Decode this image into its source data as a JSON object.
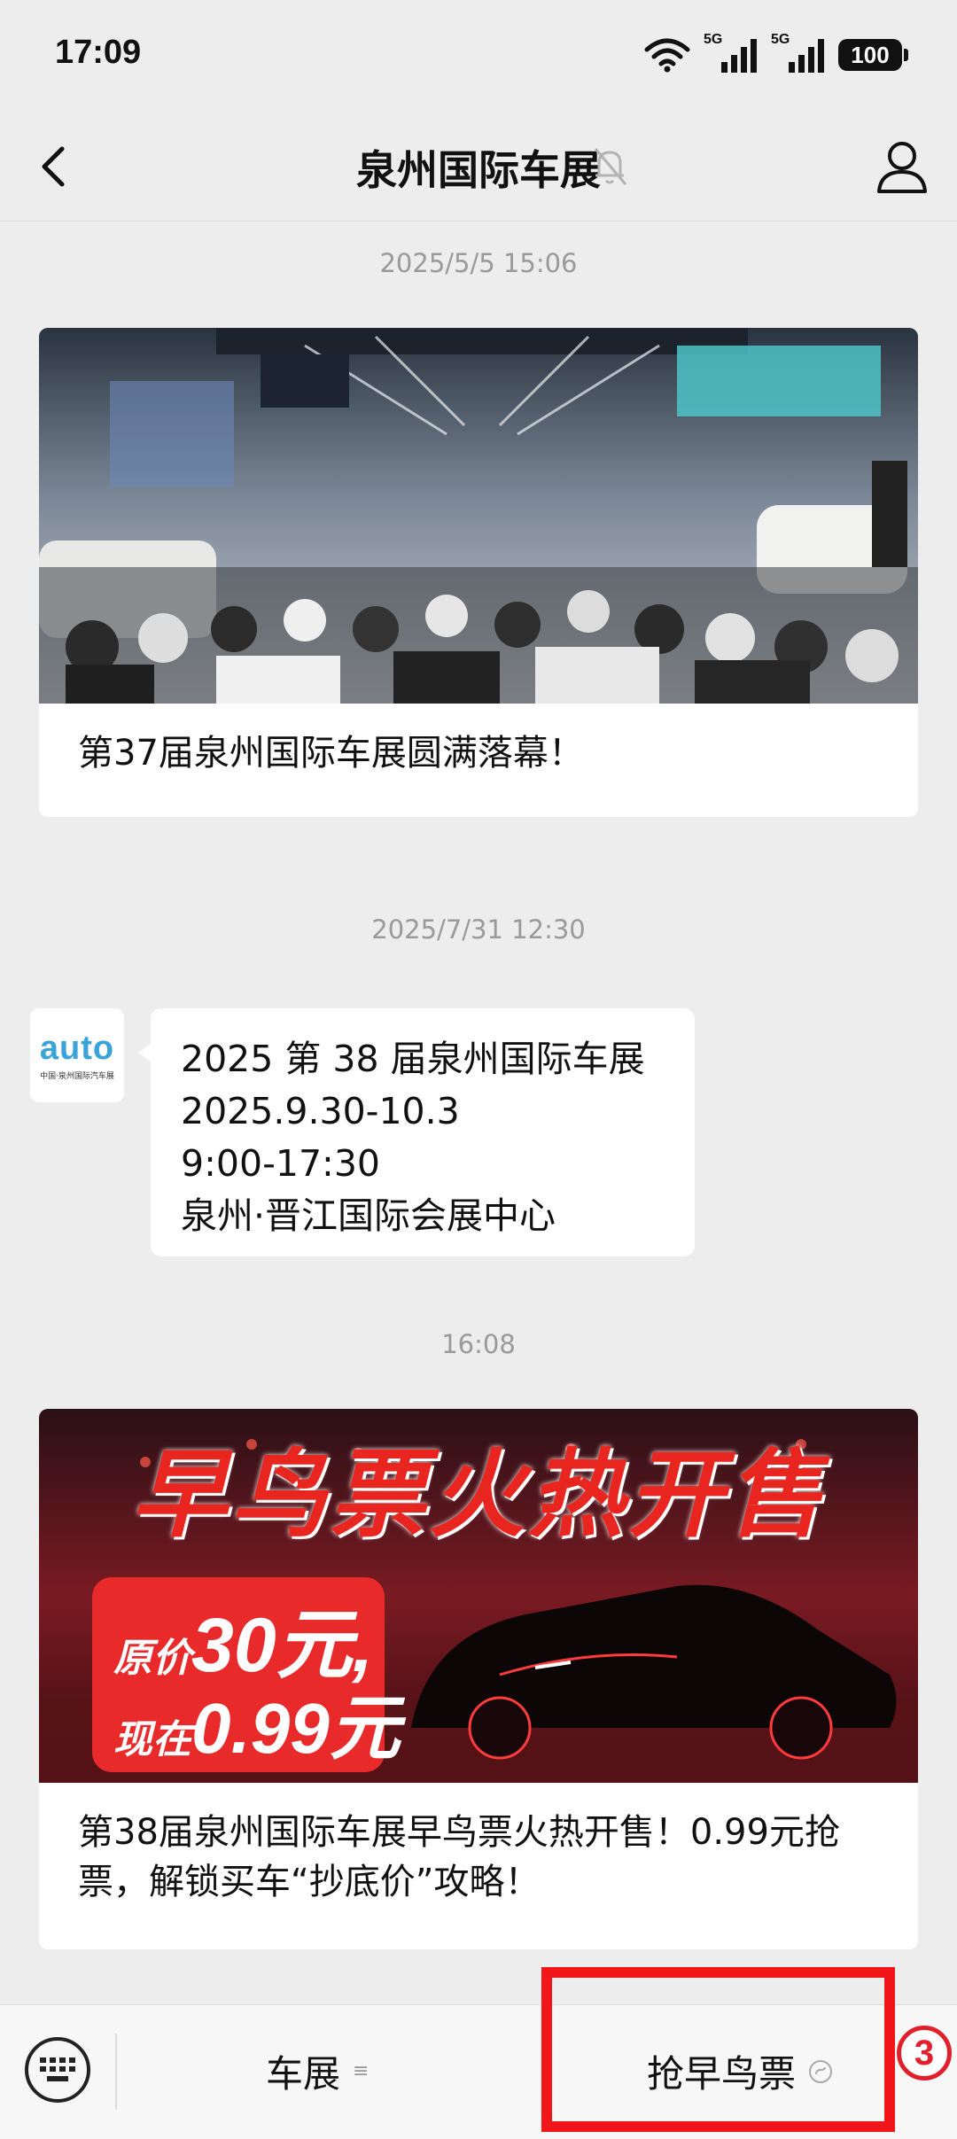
{
  "status_bar": {
    "time": "17:09",
    "sig1": "5G",
    "sig2": "5G",
    "battery": "100"
  },
  "nav": {
    "title": "泉州国际车展"
  },
  "messages": [
    {
      "timestamp": "2025/5/5 15:06",
      "caption": "第37届泉州国际车展圆满落幕！"
    },
    {
      "timestamp": "2025/7/31 12:30",
      "avatar_word": "auto",
      "avatar_sub": "中国·泉州国际汽车展",
      "lines": [
        "2025 第 38 届泉州国际车展",
        "2025.9.30-10.3",
        "9:00-17:30",
        "泉州·晋江国际会展中心"
      ]
    },
    {
      "timestamp": "16:08",
      "banner_headline": "早鸟票火热开售",
      "banner_price_line1_prefix": "原价",
      "banner_price_line1_num": "30元,",
      "banner_price_line2_prefix": "现在",
      "banner_price_line2_num": "0.99元",
      "caption": "第38届泉州国际车展早鸟票火热开售！0.99元抢票，解锁买车“抄底价”攻略！"
    }
  ],
  "bottom_menu": {
    "items": [
      {
        "label": "车展"
      },
      {
        "label": "抢早鸟票"
      }
    ],
    "annotation": "3"
  },
  "colors": {
    "accent_red": "#f2151a",
    "background": "#ededed"
  }
}
